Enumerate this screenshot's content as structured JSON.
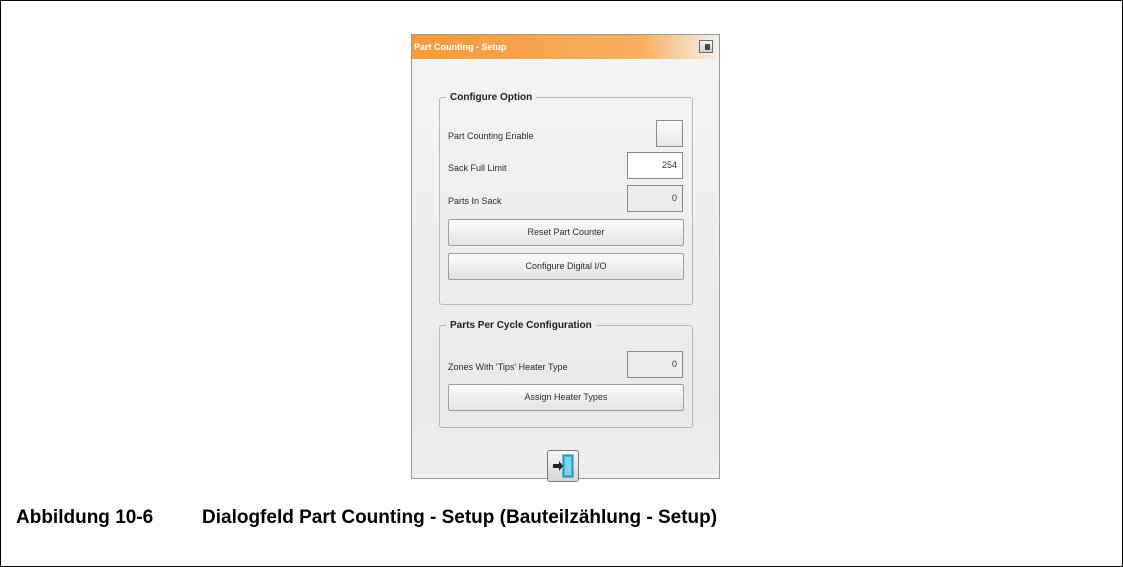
{
  "dialog": {
    "title": "Part Counting - Setup",
    "configure_option": {
      "legend": "Configure Option",
      "part_counting_enable_label": "Part Counting Enable",
      "sack_full_limit_label": "Sack Full Limit",
      "sack_full_limit_value": "254",
      "parts_in_sack_label": "Parts In Sack",
      "parts_in_sack_value": "0",
      "reset_button": "Reset Part Counter",
      "configure_io_button": "Configure Digital I/O"
    },
    "parts_per_cycle": {
      "legend": "Parts Per Cycle Configuration",
      "zones_label": "Zones With 'Tips' Heater Type",
      "zones_value": "0",
      "assign_button": "Assign Heater Types"
    },
    "exit_icon": "exit-door-icon"
  },
  "caption": {
    "number": "Abbildung 10-6",
    "text": "Dialogfeld Part Counting - Setup (Bauteilzählung - Setup)"
  },
  "colors": {
    "title_bar": "#f6a44c",
    "exit_door": "#3fb6dc"
  }
}
